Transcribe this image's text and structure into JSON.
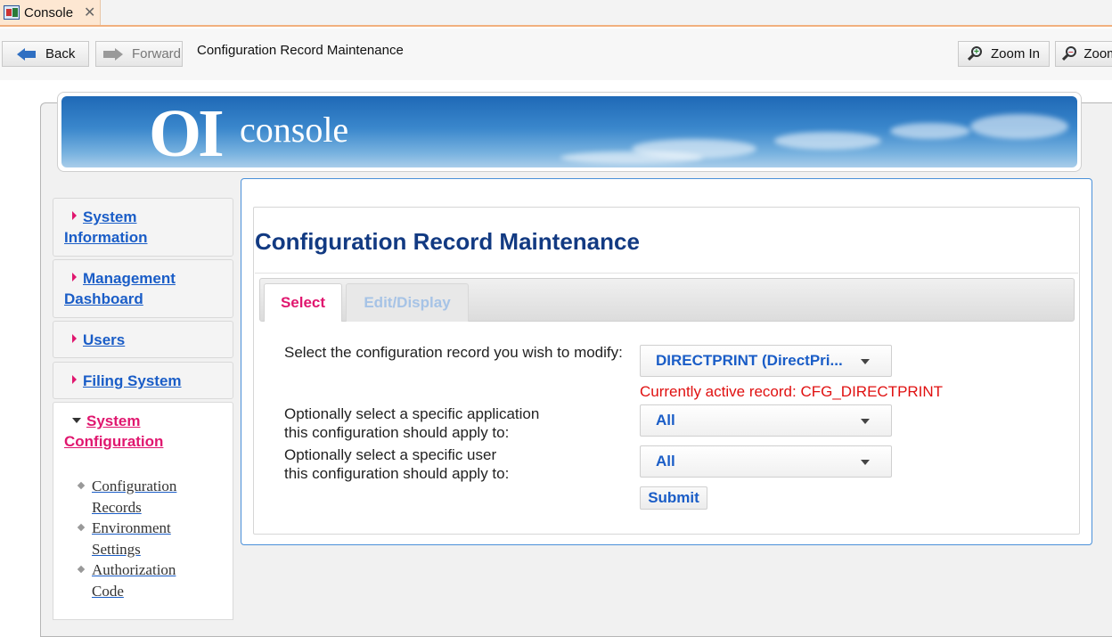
{
  "window": {
    "tab_label": "Console",
    "tab_close": "✕"
  },
  "toolbar": {
    "back_label": "Back",
    "forward_label": "Forward",
    "title": "Configuration Record Maintenance",
    "zoom_in_label": "Zoom In",
    "zoom_out_label": "Zoom Out"
  },
  "banner": {
    "logo_mark": "OI",
    "logo_text": "console"
  },
  "sidebar": {
    "items": [
      {
        "label": "System Information"
      },
      {
        "label": "Management Dashboard"
      },
      {
        "label": "Users"
      },
      {
        "label": "Filing System"
      },
      {
        "label": "System Configuration",
        "active": true
      }
    ],
    "sub_items": [
      {
        "label": "Configuration Records"
      },
      {
        "label": "Environment Settings"
      },
      {
        "label": "Authorization Code"
      }
    ]
  },
  "main": {
    "title": "Configuration Record Maintenance",
    "tabs": [
      {
        "label": "Select",
        "active": true
      },
      {
        "label": "Edit/Display",
        "active": false
      }
    ],
    "form": {
      "record_label": "Select the configuration record you wish to modify:",
      "record_value": "DIRECTPRINT (DirectPri...",
      "active_record_text": "Currently active record: CFG_DIRECTPRINT",
      "application_label_1": "Optionally select a specific application",
      "application_label_2": "this configuration should apply to:",
      "application_value": "All",
      "user_label_1": "Optionally select a specific user",
      "user_label_2": "this configuration should apply to:",
      "user_value": "All",
      "submit_label": "Submit"
    }
  },
  "colors": {
    "accent_pink": "#e0176f",
    "link_blue": "#1a5dc7",
    "title_navy": "#123a82",
    "status_red": "#e01010",
    "panel_border": "#4a90d9"
  }
}
